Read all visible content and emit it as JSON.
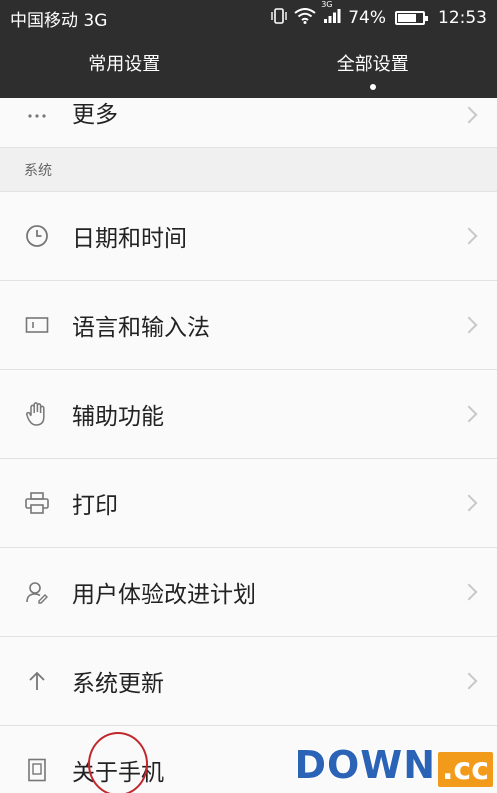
{
  "statusbar": {
    "carrier": "中国移动 3G",
    "network_label": "3G",
    "battery_percent": "74%",
    "battery_level": 0.74,
    "time": "12:53"
  },
  "tabs": [
    {
      "label": "常用设置",
      "active": false
    },
    {
      "label": "全部设置",
      "active": true
    }
  ],
  "list": {
    "more_label": "更多",
    "section_system": "系统",
    "items": [
      {
        "label": "日期和时间",
        "icon": "clock-icon"
      },
      {
        "label": "语言和输入法",
        "icon": "keyboard-icon"
      },
      {
        "label": "辅助功能",
        "icon": "hand-icon"
      },
      {
        "label": "打印",
        "icon": "printer-icon"
      },
      {
        "label": "用户体验改进计划",
        "icon": "user-icon"
      },
      {
        "label": "系统更新",
        "icon": "arrow-up-icon"
      },
      {
        "label": "关于手机",
        "icon": "phone-icon"
      }
    ]
  },
  "watermark": {
    "main": "DOWN",
    "suffix": ".cc"
  }
}
